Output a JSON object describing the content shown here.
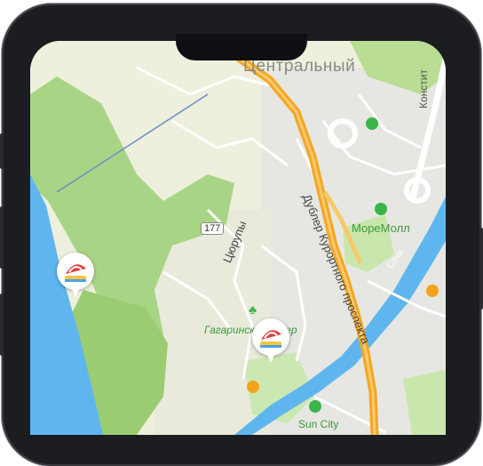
{
  "map": {
    "district_label": "Центральный",
    "street_right_label": "Констит",
    "avenue_label": "Дублер Курортного проспекта",
    "street_label": "Цюрупы",
    "route_number": "177",
    "mall_label": "МореМолл",
    "river_label": "Сочи",
    "park_label": "Гагаринский сквер",
    "suncity_label": "Sun City"
  },
  "colors": {
    "land": "#eef0dd",
    "park": "#c7e3a8",
    "forest": "#9fcf78",
    "water": "#5fb6ee",
    "highway": "#f5a623",
    "road": "#ffffff",
    "poi_green": "#39b54a",
    "poi_orange": "#f2a31a"
  },
  "icons": {
    "beach_pin": "beach-umbrella-icon",
    "shop": "shopping-bag-icon",
    "museum": "museum-icon",
    "tree": "tree-icon"
  }
}
